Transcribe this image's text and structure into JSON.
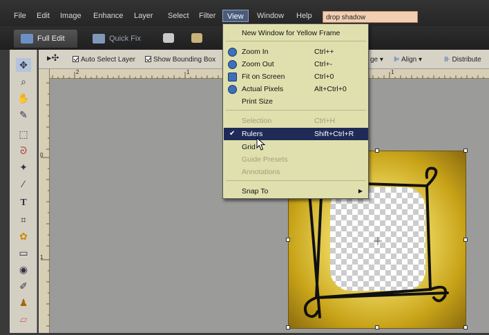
{
  "menubar": {
    "items": [
      "File",
      "Edit",
      "Image",
      "Enhance",
      "Layer",
      "Select",
      "Filter",
      "View",
      "Window",
      "Help"
    ],
    "active": "View",
    "search_value": "drop shadow"
  },
  "modes": {
    "full_edit": "Full Edit",
    "quick_fix": "Quick Fix"
  },
  "options": {
    "auto_select_layer": "Auto Select Layer",
    "show_bounding_box": "Show Bounding Box",
    "arrange": "ge",
    "align": "Align",
    "distribute": "Distribute"
  },
  "rulers": {
    "h_ticks": [
      "2",
      "1",
      "1"
    ],
    "v_ticks": [
      "0",
      "1"
    ]
  },
  "view_menu": {
    "items": [
      {
        "label": "New Window for Yellow Frame",
        "shortcut": "",
        "state": "normal",
        "icon": ""
      },
      {
        "label": "Zoom In",
        "shortcut": "Ctrl++",
        "state": "normal",
        "icon": "zoom-in-icon"
      },
      {
        "label": "Zoom Out",
        "shortcut": "Ctrl+-",
        "state": "normal",
        "icon": "zoom-out-icon"
      },
      {
        "label": "Fit on Screen",
        "shortcut": "Ctrl+0",
        "state": "normal",
        "icon": "fit-screen-icon"
      },
      {
        "label": "Actual Pixels",
        "shortcut": "Alt+Ctrl+0",
        "state": "normal",
        "icon": "actual-pixels-icon"
      },
      {
        "label": "Print Size",
        "shortcut": "",
        "state": "normal",
        "icon": ""
      },
      {
        "label": "Selection",
        "shortcut": "Ctrl+H",
        "state": "disabled",
        "icon": ""
      },
      {
        "label": "Rulers",
        "shortcut": "Shift+Ctrl+R",
        "state": "selected",
        "icon": "",
        "checked": true
      },
      {
        "label": "Grid",
        "shortcut": "",
        "state": "normal",
        "icon": ""
      },
      {
        "label": "Guide Presets",
        "shortcut": "",
        "state": "disabled",
        "icon": ""
      },
      {
        "label": "Annotations",
        "shortcut": "",
        "state": "disabled",
        "icon": ""
      },
      {
        "label": "Snap To",
        "shortcut": "",
        "state": "normal",
        "icon": "",
        "submenu": true
      }
    ]
  },
  "colors": {
    "menu_bg": "#dfe0ae",
    "selected_bg": "#1f2b56",
    "frame_yellow": "#e7d056"
  }
}
